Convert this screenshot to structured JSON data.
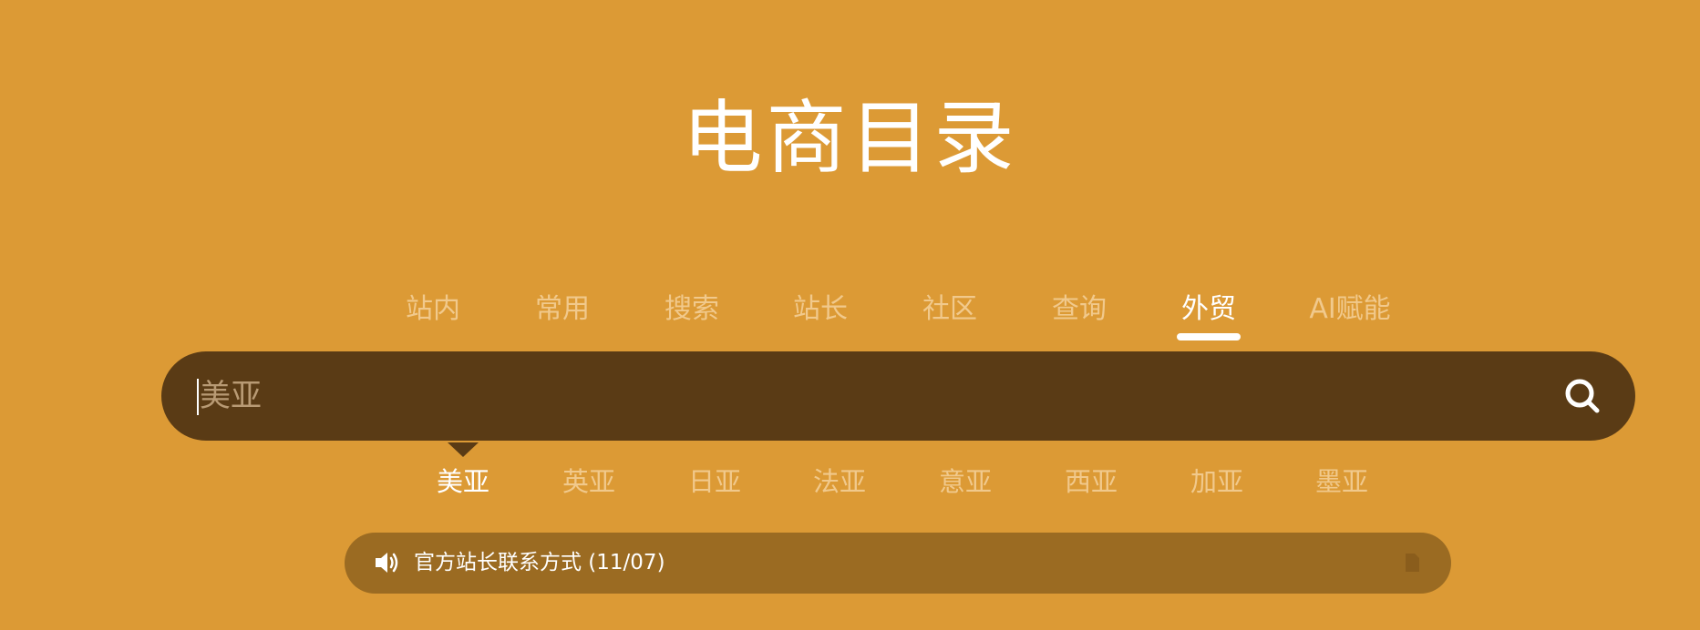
{
  "site": {
    "title": "电商目录"
  },
  "category_tabs": [
    {
      "label": "站内",
      "active": false
    },
    {
      "label": "常用",
      "active": false
    },
    {
      "label": "搜索",
      "active": false
    },
    {
      "label": "站长",
      "active": false
    },
    {
      "label": "社区",
      "active": false
    },
    {
      "label": "查询",
      "active": false
    },
    {
      "label": "外贸",
      "active": true
    },
    {
      "label": "AI赋能",
      "active": false
    }
  ],
  "search": {
    "placeholder": "美亚",
    "value": "",
    "button_icon": "search-icon"
  },
  "sub_tabs": [
    {
      "label": "美亚",
      "active": true
    },
    {
      "label": "英亚",
      "active": false
    },
    {
      "label": "日亚",
      "active": false
    },
    {
      "label": "法亚",
      "active": false
    },
    {
      "label": "意亚",
      "active": false
    },
    {
      "label": "西亚",
      "active": false
    },
    {
      "label": "加亚",
      "active": false
    },
    {
      "label": "墨亚",
      "active": false
    }
  ],
  "notice": {
    "icon": "speaker-icon",
    "text": "官方站长联系方式 (11/07)",
    "trailing_icon": "document-icon"
  },
  "colors": {
    "background": "#dc9a35",
    "search_bar": "#5a3b15",
    "notice_bar": "#9b6b22",
    "tab_inactive": "#f1c98c",
    "tab_active": "#ffffff"
  }
}
